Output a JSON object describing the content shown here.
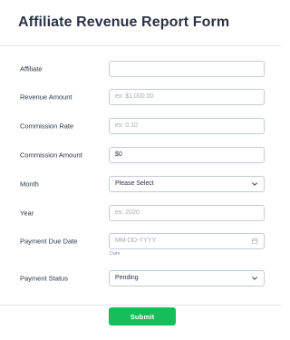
{
  "form": {
    "title": "Affiliate Revenue Report Form",
    "fields": [
      {
        "label": "Affiliate",
        "type": "text",
        "value": "",
        "placeholder": ""
      },
      {
        "label": "Revenue Amount",
        "type": "text",
        "value": "",
        "placeholder": "ex: $1,000.00"
      },
      {
        "label": "Commission Rate",
        "type": "text",
        "value": "",
        "placeholder": "ex: 0.10"
      },
      {
        "label": "Commission Amount",
        "type": "text",
        "value": "$0",
        "placeholder": ""
      },
      {
        "label": "Month",
        "type": "select",
        "value": "Please Select",
        "placeholder": ""
      },
      {
        "label": "Year",
        "type": "text",
        "value": "",
        "placeholder": "ex: 2020"
      },
      {
        "label": "Payment Due Date",
        "type": "date",
        "value": "",
        "placeholder": "MM-DD-YYYY",
        "sublabel": "Date"
      },
      {
        "label": "Payment Status",
        "type": "select",
        "value": "Pending",
        "placeholder": ""
      }
    ],
    "submit_label": "Submit"
  },
  "icons": {
    "select": "chevron-down-icon",
    "date": "calendar-icon"
  },
  "colors": {
    "title": "#2c3345",
    "border": "#c3cad8",
    "placeholder": "#a4aab6",
    "submit_bg": "#18bd5b",
    "submit_text": "#ffffff"
  }
}
